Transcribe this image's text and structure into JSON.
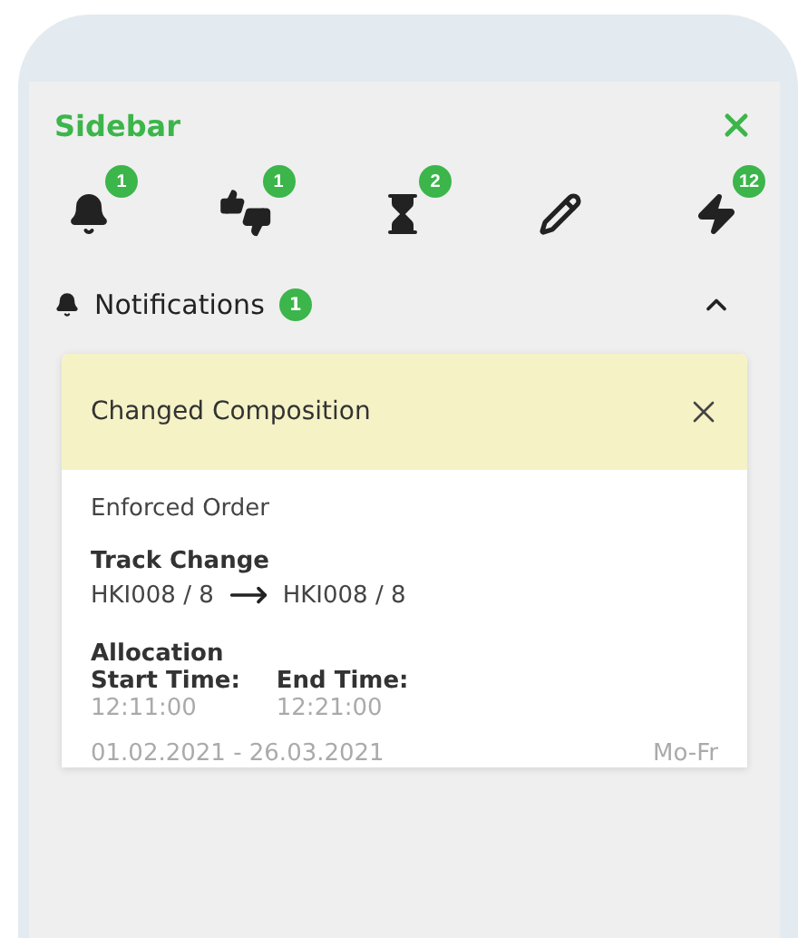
{
  "sidebar": {
    "title": "Sidebar",
    "tools": [
      {
        "kind": "bell",
        "badge": "1"
      },
      {
        "kind": "thumbs",
        "badge": "1"
      },
      {
        "kind": "hourglass",
        "badge": "2"
      },
      {
        "kind": "pencil"
      },
      {
        "kind": "bolt",
        "badge": "12"
      }
    ],
    "section": {
      "title": "Notifications",
      "badge": "1",
      "expanded": true,
      "card": {
        "title": "Changed Composition",
        "type": "Enforced Order",
        "track_label": "Track Change",
        "track_from": "HKI008 / 8",
        "track_to": "HKI008 / 8",
        "allocation_label": "Allocation",
        "start_label": "Start Time:",
        "start_value": "12:11:00",
        "end_label": "End Time:",
        "end_value": "12:21:00",
        "date_range": "01.02.2021 - 26.03.2021",
        "days": "Mo-Fr"
      }
    }
  }
}
